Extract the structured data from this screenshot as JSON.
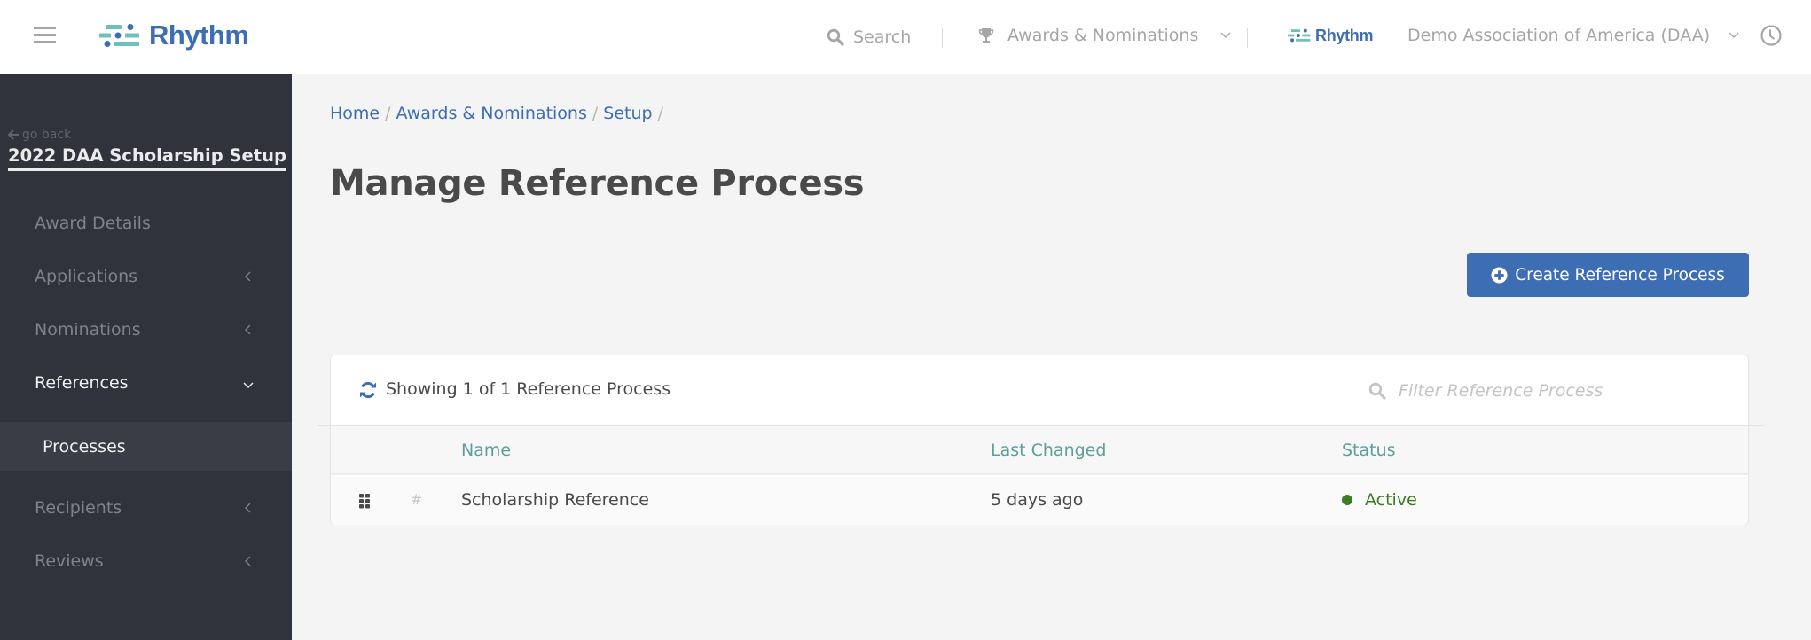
{
  "header": {
    "brand": "Rhythm",
    "search_label": "Search",
    "module_label": "Awards & Nominations",
    "module_icon": "trophy-icon",
    "secondary_brand": "Rhythm",
    "organization": "Demo Association of America (DAA)",
    "icons": [
      "hamburger-menu-icon",
      "search-icon",
      "trophy-icon",
      "chevron-down-icon",
      "clock-icon"
    ]
  },
  "sidebar": {
    "go_back": "go back",
    "title": "2022 DAA Scholarship Setup",
    "items": [
      {
        "label": "Award Details",
        "arrow": null
      },
      {
        "label": "Applications",
        "arrow": "chevron-left"
      },
      {
        "label": "Nominations",
        "arrow": "chevron-left"
      },
      {
        "label": "References",
        "arrow": "chevron-down",
        "expanded": true,
        "children": [
          {
            "label": "Processes",
            "active": true
          }
        ]
      },
      {
        "label": "Recipients",
        "arrow": "chevron-left"
      },
      {
        "label": "Reviews",
        "arrow": "chevron-left"
      }
    ]
  },
  "breadcrumb": {
    "items": [
      "Home",
      "Awards & Nominations",
      "Setup"
    ],
    "separator": "/"
  },
  "page": {
    "title": "Manage Reference Process",
    "create_button": "Create Reference Process"
  },
  "table": {
    "showing_text": "Showing 1 of 1 Reference Process",
    "filter_placeholder": "Filter Reference Process",
    "filter_value": "",
    "columns": [
      "Name",
      "Last Changed",
      "Status"
    ],
    "rows": [
      {
        "hash": "#",
        "name": "Scholarship Reference",
        "last_changed": "5 days ago",
        "status": "Active"
      }
    ]
  },
  "colors": {
    "brand_blue": "#3d6db3",
    "brand_teal": "#6cc1b8",
    "sidebar_bg": "#30333b",
    "column_header": "#5c9e9a",
    "status_active": "#3b7d23"
  }
}
